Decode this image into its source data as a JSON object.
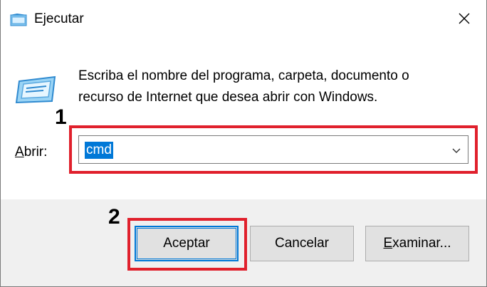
{
  "window": {
    "title": "Ejecutar",
    "app_icon": "run-dialog-icon",
    "close_icon": "close-icon"
  },
  "description": {
    "line1": "Escriba el nombre del programa, carpeta, documento o",
    "line2": "recurso de Internet que desea abrir con Windows."
  },
  "open_field": {
    "label_access_key": "A",
    "label_rest": "brir:",
    "value": "cmd",
    "dropdown_icon": "chevron-down-icon"
  },
  "buttons": {
    "ok": "Aceptar",
    "cancel": "Cancelar",
    "browse_access_key": "E",
    "browse_rest": "xaminar..."
  },
  "annotations": {
    "step1": "1",
    "step2": "2",
    "highlight_color": "#e0202c"
  },
  "colors": {
    "selection": "#0078d7",
    "footer_bg": "#f0f0f0",
    "button_bg": "#e1e1e1"
  }
}
